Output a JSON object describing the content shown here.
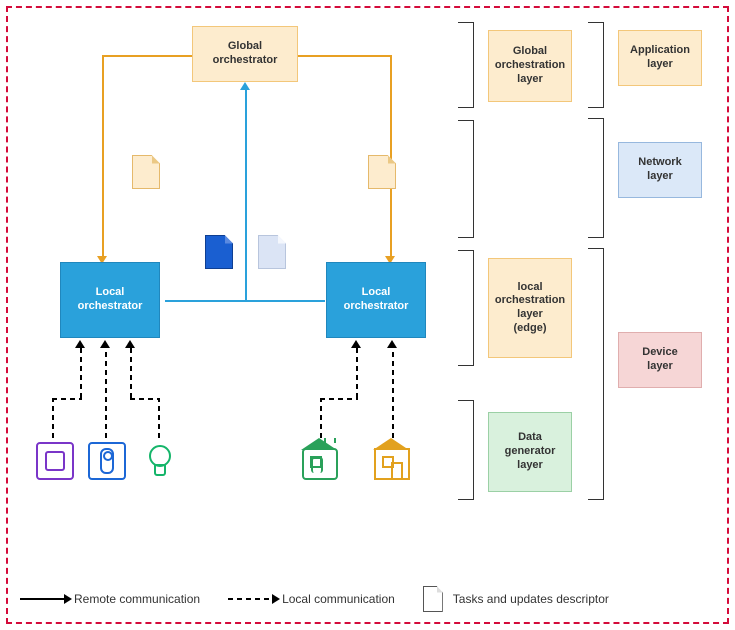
{
  "nodes": {
    "global": "Global\norchestrator",
    "local1": "Local\norchestrator",
    "local2": "Local\norchestrator"
  },
  "layers": {
    "globalOrch": "Global\norchestration\nlayer",
    "localOrch": "local\norchestration\nlayer\n(edge)",
    "dataGen": "Data\ngenerator\nlayer",
    "app": "Application\nlayer",
    "net": "Network\nlayer",
    "dev": "Device\nlayer"
  },
  "legend": {
    "remote": "Remote communication",
    "local": "Local communication",
    "doc": "Tasks and updates descriptor"
  }
}
